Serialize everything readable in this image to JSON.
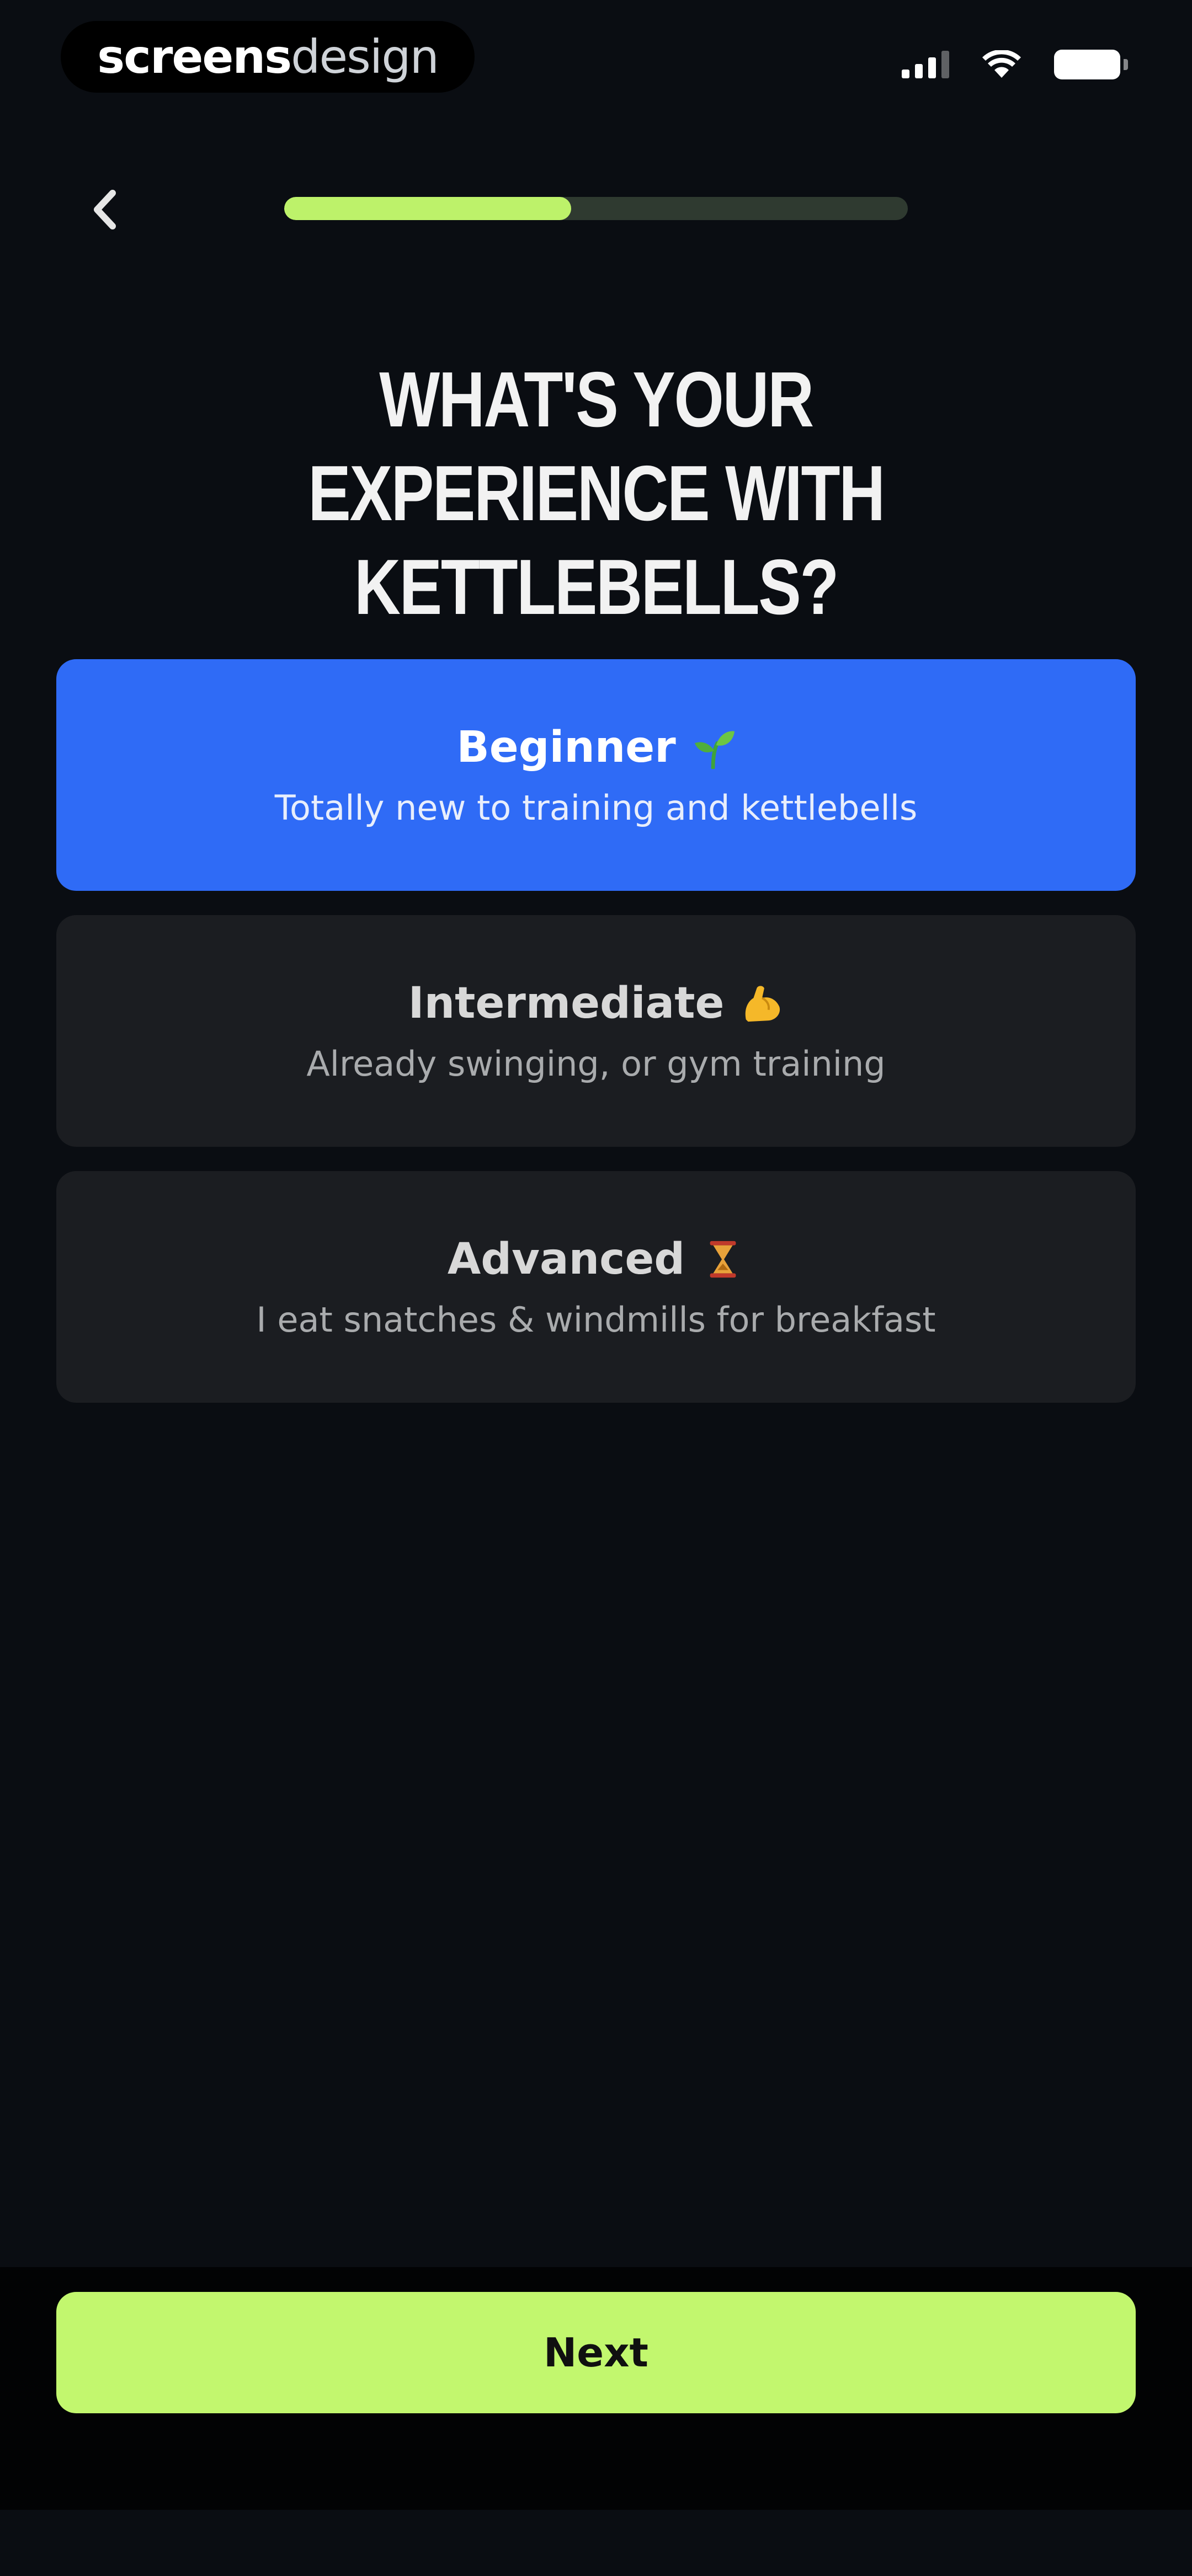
{
  "status_bar": {
    "brand_part1": "screens",
    "brand_part2": "design",
    "icons": [
      "signal-icon",
      "wifi-icon",
      "battery-icon"
    ]
  },
  "header": {
    "back_icon": "chevron-left-icon",
    "progress_fraction": 0.46
  },
  "title": "WHAT'S YOUR EXPERIENCE WITH KETTLEBELLS?",
  "options": [
    {
      "label": "Beginner",
      "icon": "seedling-emoji",
      "description": "Totally new to training and kettlebells",
      "selected": true
    },
    {
      "label": "Intermediate",
      "icon": "flexed-biceps-emoji",
      "description": "Already swinging, or gym training",
      "selected": false
    },
    {
      "label": "Advanced",
      "icon": "hourglass-emoji",
      "description": "I eat snatches & windmills for breakfast",
      "selected": false
    }
  ],
  "next_button": {
    "label": "Next"
  },
  "colors": {
    "background": "#0a0d12",
    "accent_green": "#c2f76e",
    "selected_blue": "#2f6bf6",
    "card": "#1b1d21"
  }
}
